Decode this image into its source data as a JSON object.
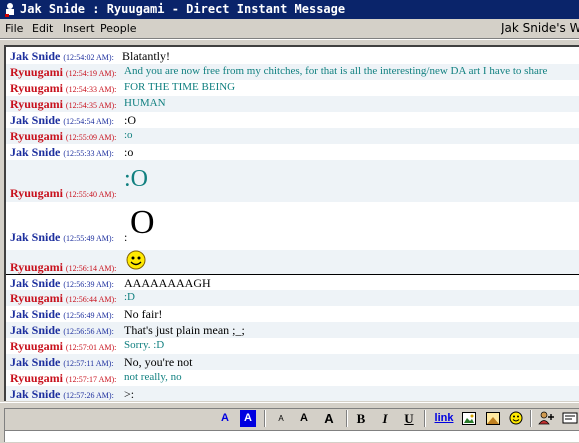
{
  "window": {
    "title": "Jak Snide : Ryuugami - Direct Instant Message"
  },
  "menu": {
    "file": "File",
    "edit": "Edit",
    "insert": "Insert",
    "people": "People",
    "right_text": "Jak Snide's W..."
  },
  "messages": [
    {
      "sender": "Jak Snide",
      "time": "(12:54:02 AM):",
      "text": "Blatantly!",
      "who": "jak"
    },
    {
      "sender": "Ryuugami",
      "time": "(12:54:19 AM):",
      "text": "And you are now free from my chitches, for that is all the interesting/new DA art I have to share",
      "who": "ryu"
    },
    {
      "sender": "Ryuugami",
      "time": "(12:54:33 AM):",
      "text": "FOR THE TIME BEING",
      "who": "ryu"
    },
    {
      "sender": "Ryuugami",
      "time": "(12:54:35 AM):",
      "text": "HUMAN",
      "who": "ryu"
    },
    {
      "sender": "Jak Snide",
      "time": "(12:54:54 AM):",
      "text": ":O",
      "who": "jak"
    },
    {
      "sender": "Ryuugami",
      "time": "(12:55:09 AM):",
      "text": ":o",
      "who": "ryu"
    },
    {
      "sender": "Jak Snide",
      "time": "(12:55:33 AM):",
      "text": ":o",
      "who": "jak"
    },
    {
      "sender": "Ryuugami",
      "time": "(12:55:40 AM):",
      "text": ":O",
      "who": "ryu"
    },
    {
      "sender": "Jak Snide",
      "time": "(12:55:49 AM):",
      "text": ":",
      "big": "O",
      "who": "jak"
    },
    {
      "sender": "Ryuugami",
      "time": "(12:56:14 AM):",
      "text": "",
      "smiley": true,
      "who": "ryu"
    },
    {
      "sender": "Jak Snide",
      "time": "(12:56:39 AM):",
      "text": "AAAAAAAAGH",
      "who": "jak"
    },
    {
      "sender": "Ryuugami",
      "time": "(12:56:44 AM):",
      "text": ":D",
      "who": "ryu"
    },
    {
      "sender": "Jak Snide",
      "time": "(12:56:49 AM):",
      "text": "No fair!",
      "who": "jak"
    },
    {
      "sender": "Jak Snide",
      "time": "(12:56:56 AM):",
      "text": "That's just plain mean ;_;",
      "who": "jak"
    },
    {
      "sender": "Ryuugami",
      "time": "(12:57:01 AM):",
      "text": "Sorry.  :D",
      "who": "ryu"
    },
    {
      "sender": "Jak Snide",
      "time": "(12:57:11 AM):",
      "text": "No, you're not",
      "who": "jak"
    },
    {
      "sender": "Ryuugami",
      "time": "(12:57:17 AM):",
      "text": "not really, no",
      "who": "ryu"
    },
    {
      "sender": "Jak Snide",
      "time": "(12:57:26 AM):",
      "text": ">:",
      "who": "jak"
    }
  ],
  "toolbar": {
    "text_color": "A",
    "bg_color": "A",
    "smaller": "A",
    "normal": "A",
    "larger": "A",
    "bold": "B",
    "italic": "I",
    "underline": "U",
    "link": "link"
  }
}
